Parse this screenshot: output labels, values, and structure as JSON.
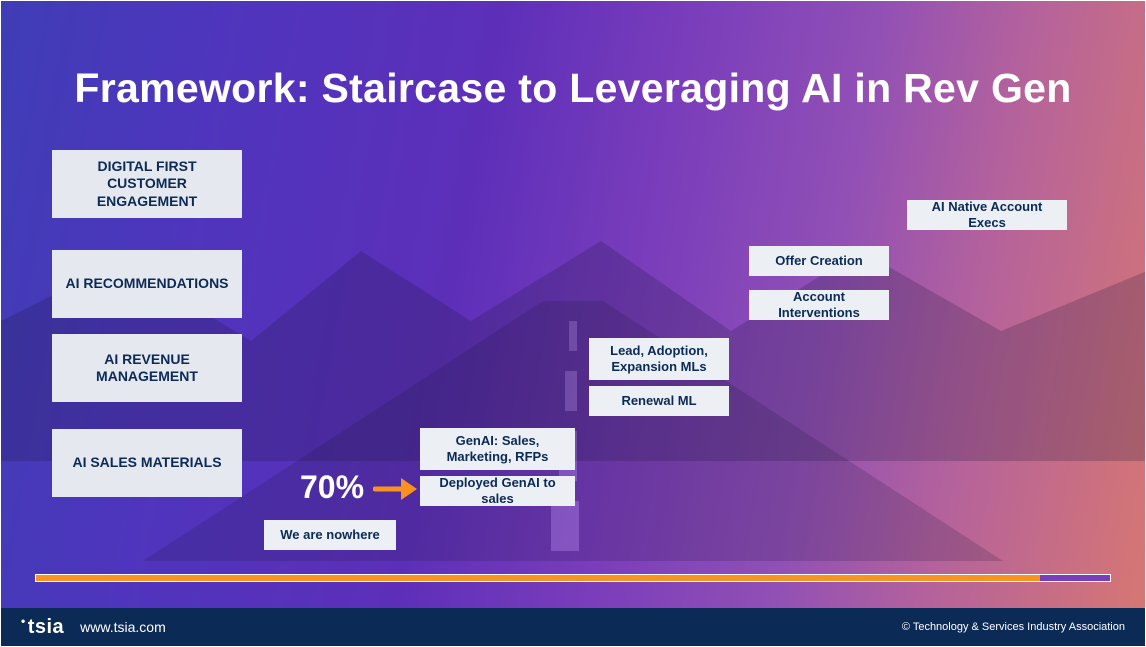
{
  "title": "Framework: Staircase to Leveraging AI in Rev Gen",
  "left_column": {
    "items": [
      "DIGITAL FIRST CUSTOMER ENGAGEMENT",
      "AI RECOMMENDATIONS",
      "AI REVENUE MANAGEMENT",
      "AI SALES MATERIALS"
    ]
  },
  "staircase": {
    "step0": {
      "label": "We are nowhere"
    },
    "step1": {
      "top": "GenAI: Sales, Marketing, RFPs",
      "bottom": "Deployed GenAI to sales",
      "percent": "70%"
    },
    "step2": {
      "top": "Lead, Adoption, Expansion MLs",
      "bottom": "Renewal ML"
    },
    "step3": {
      "top": "Offer Creation",
      "bottom": "Account Interventions"
    },
    "step4": {
      "label": "AI Native Account Execs"
    }
  },
  "footer": {
    "logo_text": "tsia",
    "website": "www.tsia.com",
    "copyright": "© Technology & Services Industry Association"
  },
  "colors": {
    "accent": "#f7931e",
    "card_bg": "#e5e8ee",
    "text_dark": "#0b2a56"
  }
}
